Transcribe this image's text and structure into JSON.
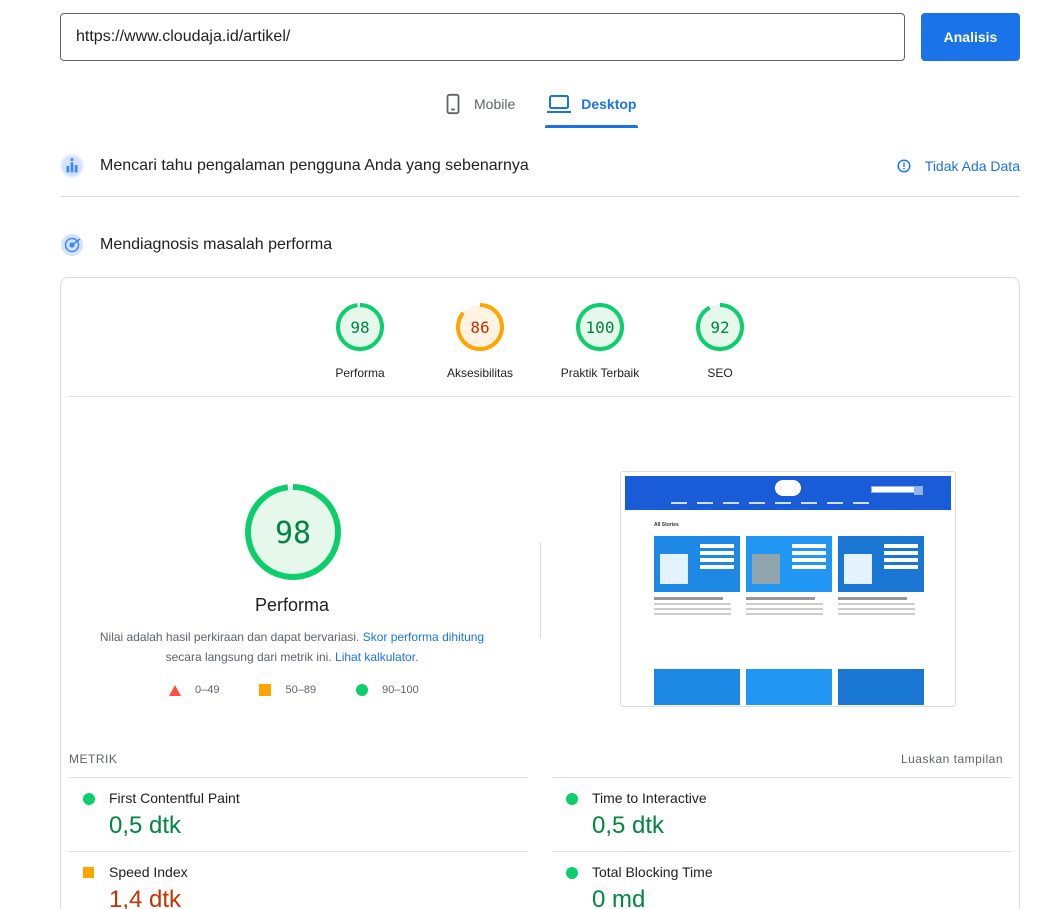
{
  "search": {
    "url_value": "https://www.cloudaja.id/artikel/",
    "analyze_label": "Analisis"
  },
  "device_tabs": [
    {
      "label": "Mobile",
      "icon": "phone-icon",
      "active": false
    },
    {
      "label": "Desktop",
      "icon": "laptop-icon",
      "active": true
    }
  ],
  "field_data": {
    "title": "Mencari tahu pengalaman pengguna Anda yang sebenarnya",
    "status_label": "Tidak Ada Data",
    "status_icon": "info-icon"
  },
  "lab_data": {
    "title": "Mendiagnosis masalah performa"
  },
  "categories": [
    {
      "label": "Performa",
      "score": "98",
      "fraction": 0.98,
      "rating": "pass"
    },
    {
      "label": "Aksesibilitas",
      "score": "86",
      "fraction": 0.86,
      "rating": "average"
    },
    {
      "label": "Praktik Terbaik",
      "score": "100",
      "fraction": 1.0,
      "rating": "pass"
    },
    {
      "label": "SEO",
      "score": "92",
      "fraction": 0.92,
      "rating": "pass"
    }
  ],
  "performance": {
    "score": "98",
    "fraction": 0.98,
    "title": "Performa",
    "note_text_1": "Nilai adalah hasil perkiraan dan dapat bervariasi. ",
    "note_link_1": "Skor performa dihitung",
    "note_text_2": "secara langsung dari metrik ini. ",
    "note_link_2": "Lihat kalkulator.",
    "legend": [
      {
        "range": "0–49",
        "shape": "triangle",
        "color": "#ff4e42"
      },
      {
        "range": "50–89",
        "shape": "square",
        "color": "#ffa400"
      },
      {
        "range": "90–100",
        "shape": "circle",
        "color": "#0cce6b"
      }
    ]
  },
  "screenshot": {
    "caption": "All Stories"
  },
  "metrics": {
    "header": "METRIK",
    "expand_label": "Luaskan tampilan",
    "items": [
      {
        "name": "First Contentful Paint",
        "value": "0,5 dtk",
        "rating": "pass"
      },
      {
        "name": "Time to Interactive",
        "value": "0,5 dtk",
        "rating": "pass"
      },
      {
        "name": "Speed Index",
        "value": "1,4 dtk",
        "rating": "average"
      },
      {
        "name": "Total Blocking Time",
        "value": "0 md",
        "rating": "pass"
      }
    ]
  },
  "colors": {
    "accent": "#1a73e8",
    "pass": "#0cce6b",
    "pass_text": "#018642",
    "average": "#ffa400",
    "average_text": "#c33300",
    "fail": "#ff4e42"
  }
}
